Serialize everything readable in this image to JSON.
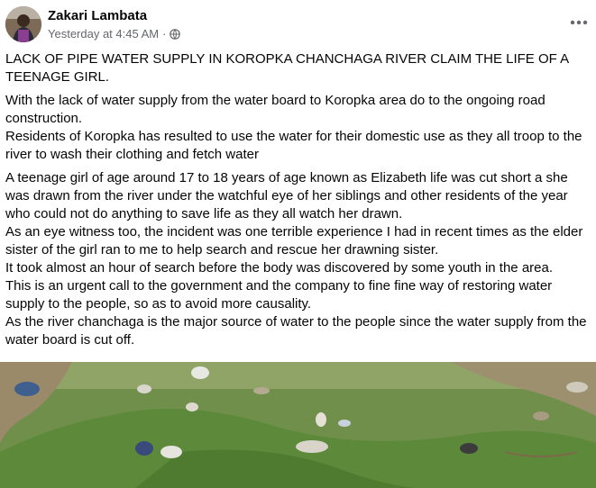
{
  "post": {
    "author": "Zakari Lambata",
    "timestamp": "Yesterday at 4:45 AM",
    "separator": "·",
    "privacy_icon": "globe-icon",
    "more_icon": "more-horizontal-icon",
    "paragraphs": [
      "LACK OF PIPE WATER SUPPLY IN KOROPKA CHANCHAGA RIVER CLAIM THE LIFE OF A TEENAGE GIRL.",
      "With the lack of water supply from the water board to Koropka area do to the ongoing road construction.\nResidents of Koropka has resulted to use the water for their domestic use as they all troop to the river to wash their clothing and fetch water",
      "A teenage girl of age around 17 to 18 years of age known as Elizabeth life was cut short a she was drawn from the river under the watchful eye of her siblings and other residents of the year who could not do anything to save life as they all watch her drawn.\nAs an eye witness too,  the incident was one terrible experience I had in recent times as the elder sister of the girl ran to me to help search and rescue her drawning sister.\nIt took almost an hour of search before the body was discovered by some youth in the area.\nThis is an urgent call to the government and the company to fine fine way of restoring water supply to the people, so as to avoid more causality.\nAs the river chanchaga is the major source of water to the people since the water supply from the water board is cut off."
    ]
  },
  "colors": {
    "text": "#050505",
    "secondary_text": "#65676b",
    "background": "#ffffff",
    "grass": "#5f8a3a"
  }
}
